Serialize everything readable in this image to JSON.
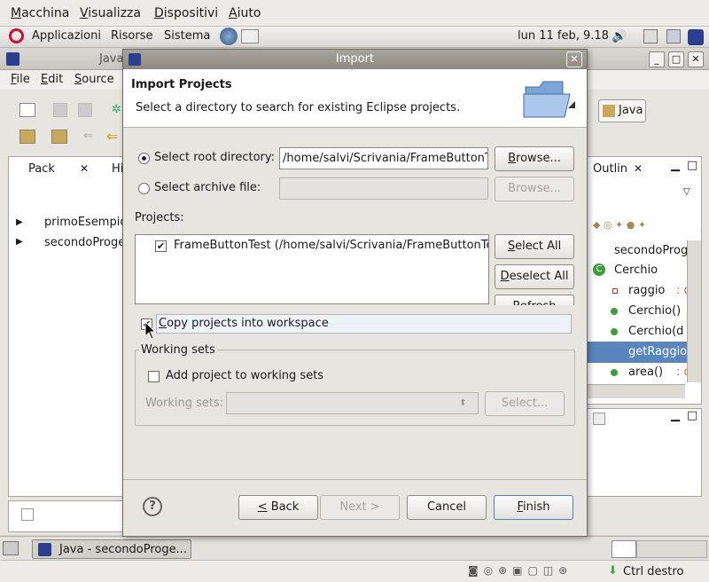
{
  "vbox_menu": [
    "Macchina",
    "Visualizza",
    "Dispositivi",
    "Aiuto"
  ],
  "gnome_panel": {
    "apps": "Applicazioni",
    "places": "Risorse",
    "system": "Sistema",
    "clock": "lun 11 feb, 9.18"
  },
  "eclipse": {
    "title_partial": "Java",
    "menu": [
      "File",
      "Edit",
      "Source"
    ],
    "perspective": "Java",
    "left_tabs": [
      "Pack",
      "Hi"
    ],
    "tree": [
      "primoEsempio",
      "secondoProge"
    ],
    "outline_tab": "Outlin",
    "outline_items": [
      "secondoProg",
      "Cerchio",
      "raggio",
      "Cerchio()",
      "Cerchio(d",
      "getRaggio",
      "area()"
    ],
    "outline_types": [
      ": d",
      ": d"
    ]
  },
  "dialog": {
    "title": "Import",
    "heading": "Import Projects",
    "description": "Select a directory to search for existing Eclipse projects.",
    "root_label": "Select root directory:",
    "root_value": "/home/salvi/Scrivania/FrameButtonTest",
    "archive_label": "Select archive file:",
    "archive_value": "",
    "browse": "Browse...",
    "projects_label": "Projects:",
    "project_entry": "FrameButtonTest (/home/salvi/Scrivania/FrameButtonTest)",
    "select_all": "Select All",
    "deselect_all": "Deselect All",
    "refresh": "Refresh",
    "copy_label": "Copy projects into workspace",
    "working_sets_group": "Working sets",
    "add_ws_label": "Add project to working sets",
    "ws_label": "Working sets:",
    "ws_select": "Select...",
    "back": "< Back",
    "next": "Next >",
    "cancel": "Cancel",
    "finish": "Finish"
  },
  "taskbar": {
    "window": "Java - secondoProge..."
  },
  "vbox_status": {
    "host_key": "Ctrl destro"
  }
}
